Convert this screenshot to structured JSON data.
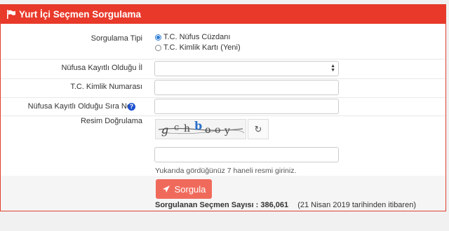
{
  "header": {
    "title": "Yurt İçi Seçmen Sorgulama"
  },
  "form": {
    "query_type": {
      "label": "Sorgulama Tipi",
      "options": [
        "T.C. Nüfus Cüzdanı",
        "T.C. Kimlik Kartı (Yeni)"
      ],
      "selected": "T.C. Nüfus Cüzdanı"
    },
    "province": {
      "label": "Nüfusa Kayıtlı Olduğu İl",
      "value": ""
    },
    "id_number": {
      "label": "T.C. Kimlik Numarası",
      "value": ""
    },
    "sequence_no": {
      "label": "Nüfusa Kayıtlı Olduğu Sıra No",
      "help_icon": "question-circle-icon"
    },
    "captcha": {
      "label": "Resim Doğrulama",
      "image_text": "gchbooy",
      "refresh_icon": "refresh-icon",
      "value": "",
      "hint": "Yukarıda gördüğünüz 7 haneli resmi giriniz."
    }
  },
  "submit": {
    "label": "Sorgula",
    "icon": "paper-plane-icon"
  },
  "stats": {
    "count_label": "Sorgulanan Seçmen Sayısı : 386,061",
    "since": "(21 Nisan 2019 tarihinden itibaren)"
  },
  "colors": {
    "header_bg": "#e8392a",
    "button_bg": "#f06a5b",
    "help_icon": "#1d4fcf"
  }
}
